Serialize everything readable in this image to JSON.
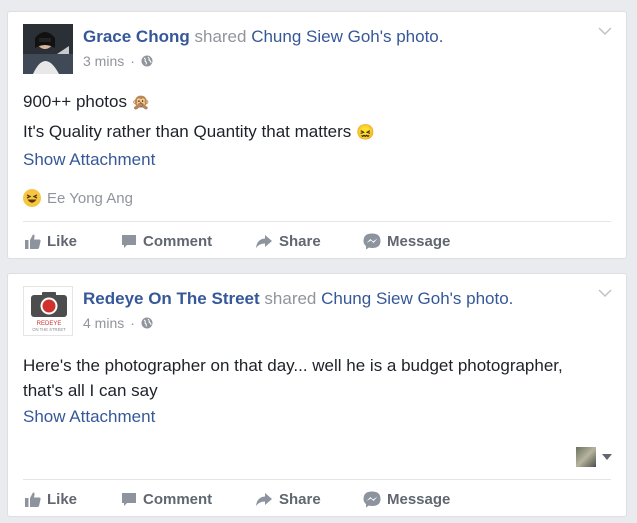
{
  "posts": [
    {
      "author": "Grace Chong",
      "verb": "shared",
      "target_owner": "Chung Siew Goh",
      "target_suffix": "'s photo.",
      "time": "3 mins",
      "dot": "·",
      "text_lines": [
        "900++ photos",
        "It's Quality rather than Quantity that matters"
      ],
      "emoji_1": "🙊",
      "emoji_2": "😖",
      "show_attachment": "Show Attachment",
      "reaction_name": "Ee Yong Ang",
      "actions": {
        "like": "Like",
        "comment": "Comment",
        "share": "Share",
        "message": "Message"
      }
    },
    {
      "author": "Redeye On The Street",
      "verb": "shared",
      "target_owner": "Chung Siew Goh",
      "target_suffix": "'s photo.",
      "time": "4 mins",
      "dot": "·",
      "text": "Here's the photographer on that day... well he is a budget photographer, that's all I can say",
      "show_attachment": "Show Attachment",
      "logo_text_1": "REDEYE",
      "logo_text_2": "ON THE STREET",
      "actions": {
        "like": "Like",
        "comment": "Comment",
        "share": "Share",
        "message": "Message"
      }
    }
  ],
  "colors": {
    "link": "#365899",
    "meta": "#90949c",
    "action": "#606770",
    "background": "#e9ebee"
  }
}
